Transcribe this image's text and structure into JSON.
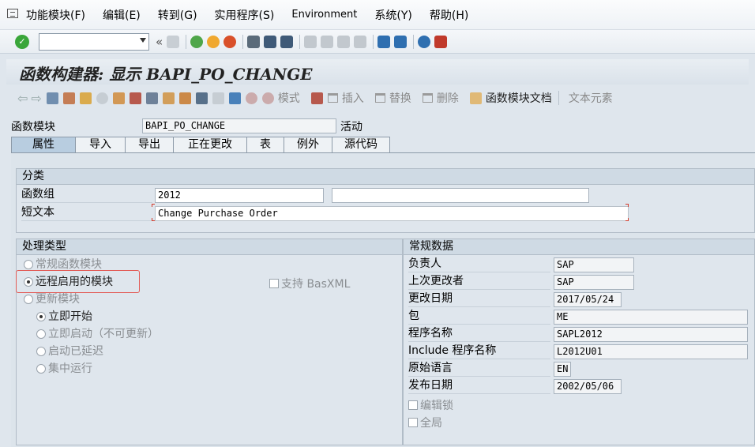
{
  "menubar": {
    "items": [
      "功能模块(F)",
      "编辑(E)",
      "转到(G)",
      "实用程序(S)",
      "Environment",
      "系统(Y)",
      "帮助(H)"
    ]
  },
  "toolbar": {
    "command_value": "",
    "back_glyph": "«"
  },
  "title": "函数构建器: 显示 BAPI_PO_CHANGE",
  "app_toolbar": {
    "mode": "模式",
    "insert": "插入",
    "replace": "替换",
    "delete": "删除",
    "doc": "函数模块文档",
    "text_elements": "文本元素"
  },
  "header": {
    "fm_label": "函数模块",
    "fm_value": "BAPI_PO_CHANGE",
    "status": "活动"
  },
  "tabs": [
    "属性",
    "导入",
    "导出",
    "正在更改",
    "表",
    "例外",
    "源代码"
  ],
  "classification": {
    "heading": "分类",
    "group_label": "函数组",
    "group_value": "2012",
    "group_value2": "",
    "short_text_label": "短文本",
    "short_text_value": "Change Purchase Order"
  },
  "processing": {
    "heading": "处理类型",
    "normal": "常规函数模块",
    "remote": "远程启用的模块",
    "basxml": "支持 BasXML",
    "update": "更新模块",
    "immediate": "立即开始",
    "immediate_nu": "立即启动（不可更新）",
    "delayed": "启动已延迟",
    "collective": "集中运行"
  },
  "general": {
    "heading": "常规数据",
    "rows": [
      {
        "label": "负责人",
        "value": "SAP"
      },
      {
        "label": "上次更改者",
        "value": "SAP"
      },
      {
        "label": "更改日期",
        "value": "2017/05/24"
      },
      {
        "label": "包",
        "value": "ME"
      },
      {
        "label": "程序名称",
        "value": "SAPL2012"
      },
      {
        "label": "Include 程序名称",
        "value": "L2012U01"
      },
      {
        "label": "原始语言",
        "value": "EN"
      },
      {
        "label": "发布日期",
        "value": "2002/05/06"
      }
    ],
    "edit_lock": "编辑锁",
    "global": "全局"
  },
  "colors": {
    "highlight": "#e25b56",
    "active_tab": "#b8cde0"
  }
}
